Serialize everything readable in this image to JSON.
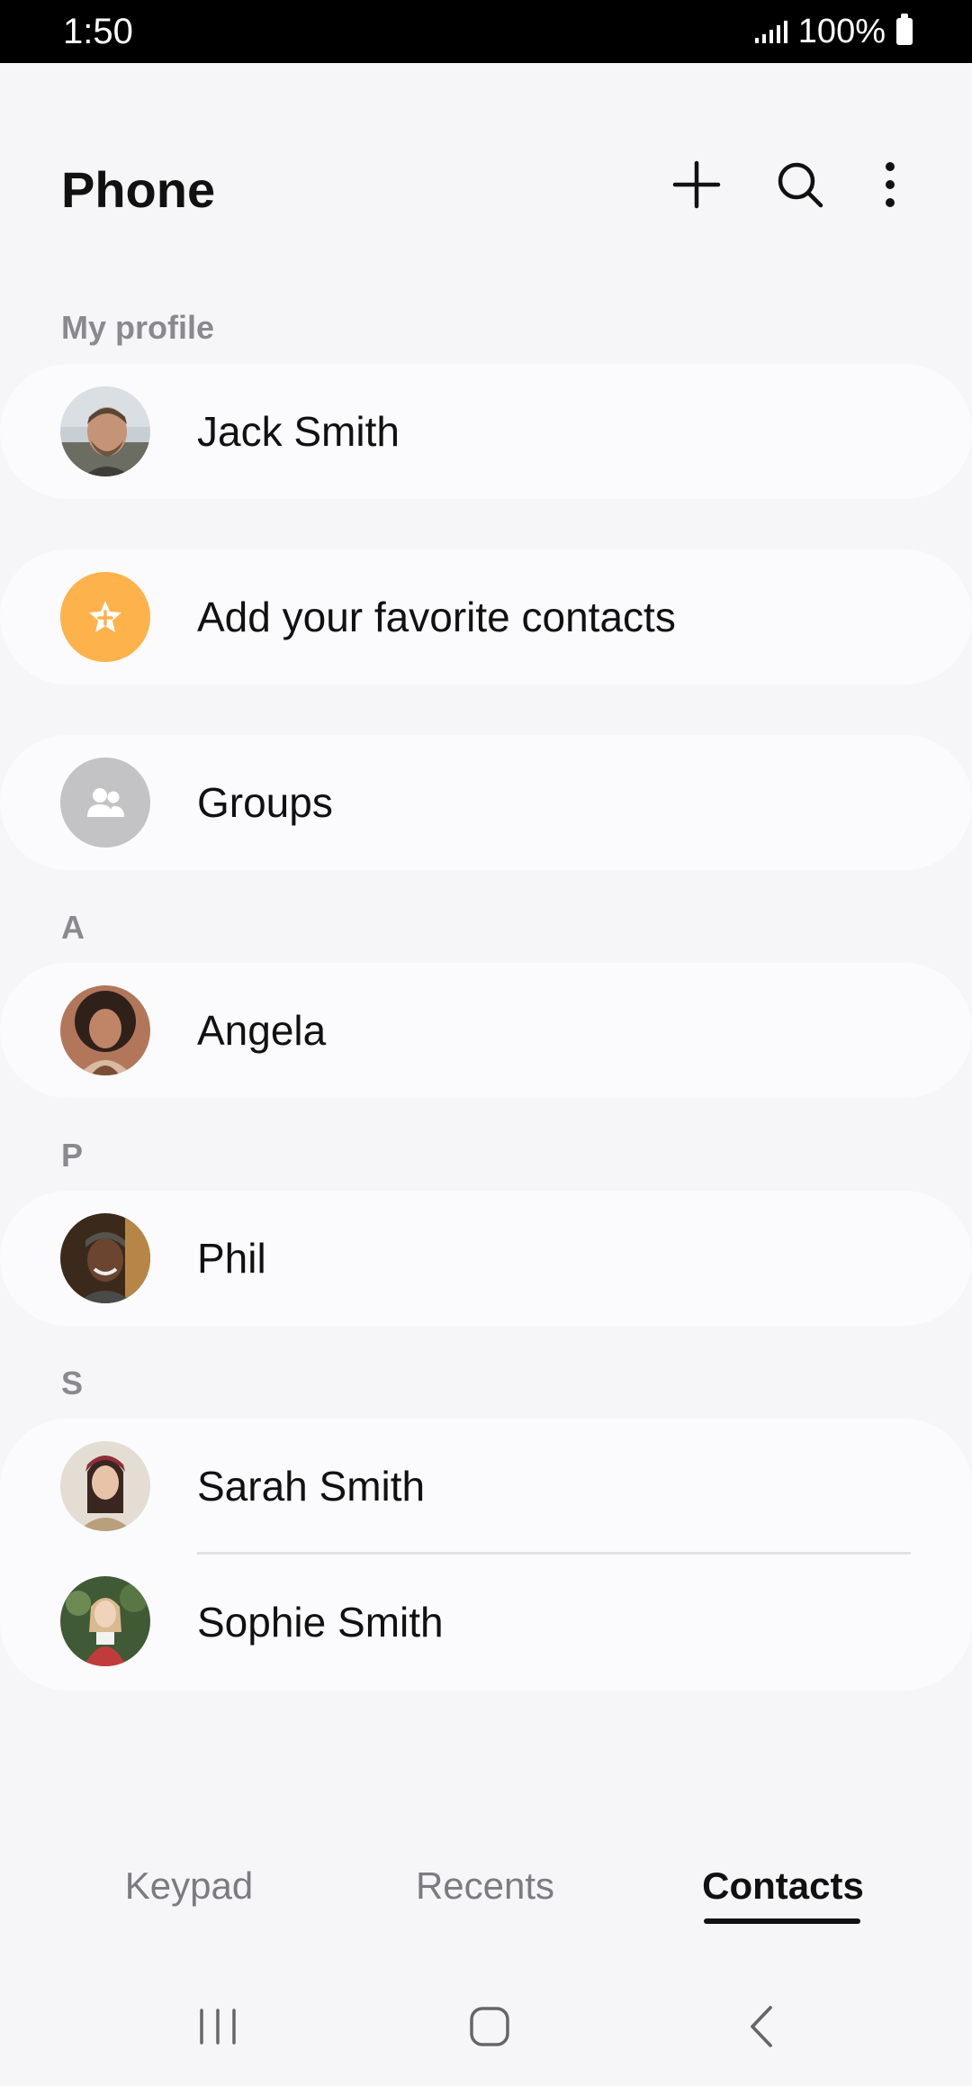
{
  "status_bar": {
    "time": "1:50",
    "battery": "100%"
  },
  "header": {
    "title": "Phone",
    "icons": [
      "plus-icon",
      "search-icon",
      "more-vert-icon"
    ]
  },
  "my_profile": {
    "label": "My profile",
    "name": "Jack Smith"
  },
  "favorites": {
    "label": "Add your favorite contacts",
    "color": "#fdb24b"
  },
  "groups": {
    "label": "Groups",
    "color": "#c3c3c6"
  },
  "sections": [
    {
      "letter": "A",
      "contacts": [
        "Angela"
      ]
    },
    {
      "letter": "P",
      "contacts": [
        "Phil"
      ]
    },
    {
      "letter": "S",
      "contacts": [
        "Sarah Smith",
        "Sophie Smith"
      ]
    }
  ],
  "tabs": [
    {
      "label": "Keypad",
      "active": false
    },
    {
      "label": "Recents",
      "active": false
    },
    {
      "label": "Contacts",
      "active": true
    }
  ],
  "nav": [
    "recent-apps-icon",
    "home-icon",
    "back-icon"
  ]
}
